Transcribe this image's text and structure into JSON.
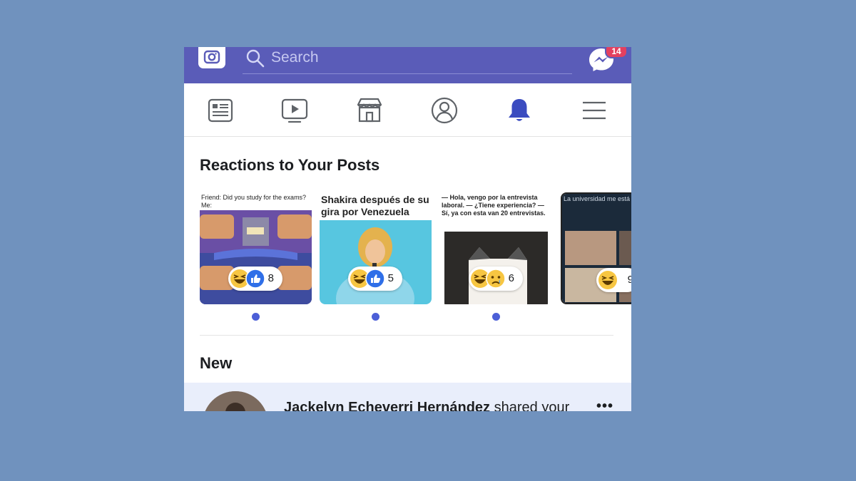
{
  "search": {
    "placeholder": "Search"
  },
  "messenger": {
    "badge_count": "14"
  },
  "nav": {
    "items": [
      "newspaper-icon",
      "video-icon",
      "marketplace-icon",
      "profile-icon",
      "bell-icon",
      "menu-icon"
    ],
    "active": "bell-icon",
    "active_color": "#3b4cc0"
  },
  "reactions": {
    "title": "Reactions to Your Posts",
    "cards": [
      {
        "caption": "Friend: Did you study for the exams? Me:",
        "reactions": [
          "haha",
          "like"
        ],
        "count": "8"
      },
      {
        "caption": "Shakira después de su gira por Venezuela",
        "reactions": [
          "haha",
          "like"
        ],
        "count": "5"
      },
      {
        "caption": "— Hola, vengo por la entrevista laboral. — ¿Tiene experiencia? — Sí, ya con esta van 20 entrevistas.",
        "reactions": [
          "haha",
          "sad"
        ],
        "count": "6"
      },
      {
        "caption": "La universidad me está matando",
        "reactions": [
          "haha"
        ],
        "count": "9"
      }
    ]
  },
  "new": {
    "title": "New",
    "notification": {
      "name": "Jackelyn Echeverri Hernández",
      "action": "shared your"
    }
  },
  "colors": {
    "background": "#7092be",
    "topbar": "#5a5cb8",
    "accent": "#4c5fd7",
    "badge": "#e4405f"
  }
}
